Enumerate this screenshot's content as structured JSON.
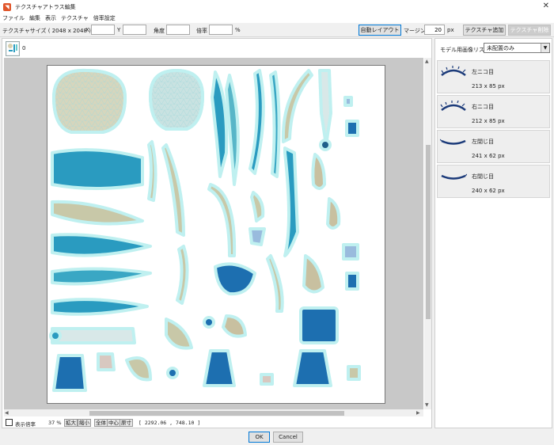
{
  "window": {
    "title": "テクスチャアトラス編集",
    "close": "✕"
  },
  "menu": [
    "ファイル",
    "編集",
    "表示",
    "テクスチャ",
    "倍率設定"
  ],
  "toolbar": {
    "texture_size": "テクスチャサイズ ( 2048 x 2048 )",
    "x_label": "X",
    "y_label": "Y",
    "angle_label": "角度",
    "scale_label": "倍率",
    "percent": "%",
    "auto_layout": "自動レイアウト",
    "margin_label": "マージン",
    "margin_value": "20",
    "px": "px",
    "add_texture": "テクスチャ追加",
    "delete_texture": "テクスチャ削除"
  },
  "texture_tab": {
    "index": "0"
  },
  "status": {
    "show_scale": "表示倍率",
    "zoom_value": "37 %",
    "zoom_in": "拡大",
    "zoom_out": "縮小",
    "fit": "全体",
    "center": "中心",
    "actual": "原寸",
    "coords": "[ 2292.06 ,  748.10 ]"
  },
  "right_panel": {
    "label": "モデル用画像リスト",
    "filter": "未配置のみ",
    "items": [
      {
        "name": "左ニコ目",
        "size": "213 x 85 px"
      },
      {
        "name": "右ニコ目",
        "size": "212 x 85 px"
      },
      {
        "name": "左閉じ目",
        "size": "241 x 62 px"
      },
      {
        "name": "右閉じ目",
        "size": "240 x 62 px"
      }
    ]
  },
  "dialog": {
    "ok": "OK",
    "cancel": "Cancel"
  },
  "colors": {
    "accent": "#0078d7",
    "part_teal": "#2a9bc0",
    "part_beige": "#c8c0a0",
    "glow": "#bff0f0"
  }
}
